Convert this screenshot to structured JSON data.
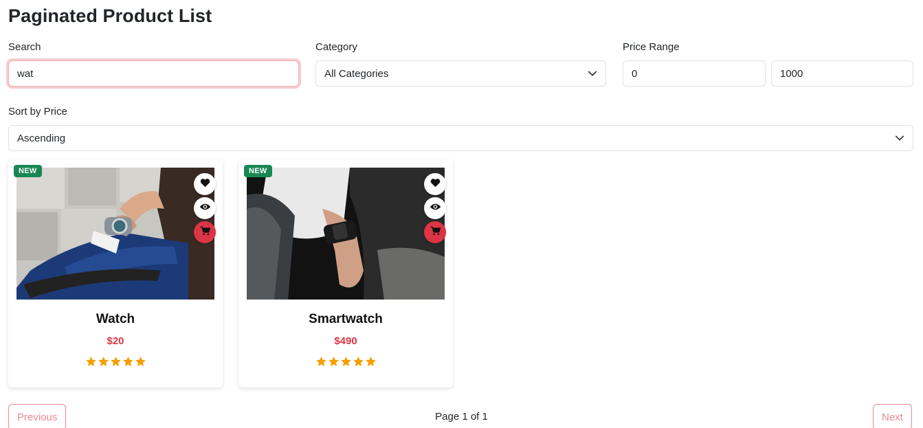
{
  "page": {
    "title": "Paginated Product List"
  },
  "filters": {
    "search_label": "Search",
    "search_value": "wat",
    "category_label": "Category",
    "category_value": "All Categories",
    "price_label": "Price Range",
    "price_min": "0",
    "price_max": "1000",
    "sort_label": "Sort by Price",
    "sort_value": "Ascending"
  },
  "products": [
    {
      "name": "Watch",
      "price": "$20",
      "badge": "NEW",
      "rating": 5,
      "image": "suited-man-checking-wristwatch-photo"
    },
    {
      "name": "Smartwatch",
      "price": "$490",
      "badge": "NEW",
      "rating": 5,
      "image": "man-wearing-smartwatch-photo"
    }
  ],
  "pagination": {
    "previous_label": "Previous",
    "next_label": "Next",
    "info": "Page 1 of 1"
  },
  "colors": {
    "accent": "#dc3545",
    "price": "#dc3545",
    "badge": "#198754",
    "star": "#f59f00"
  },
  "icons": {
    "wishlist": "heart-icon",
    "quick_view": "eye-icon",
    "cart": "cart-icon",
    "rating": "star-icon",
    "dropdown": "chevron-down-icon"
  }
}
